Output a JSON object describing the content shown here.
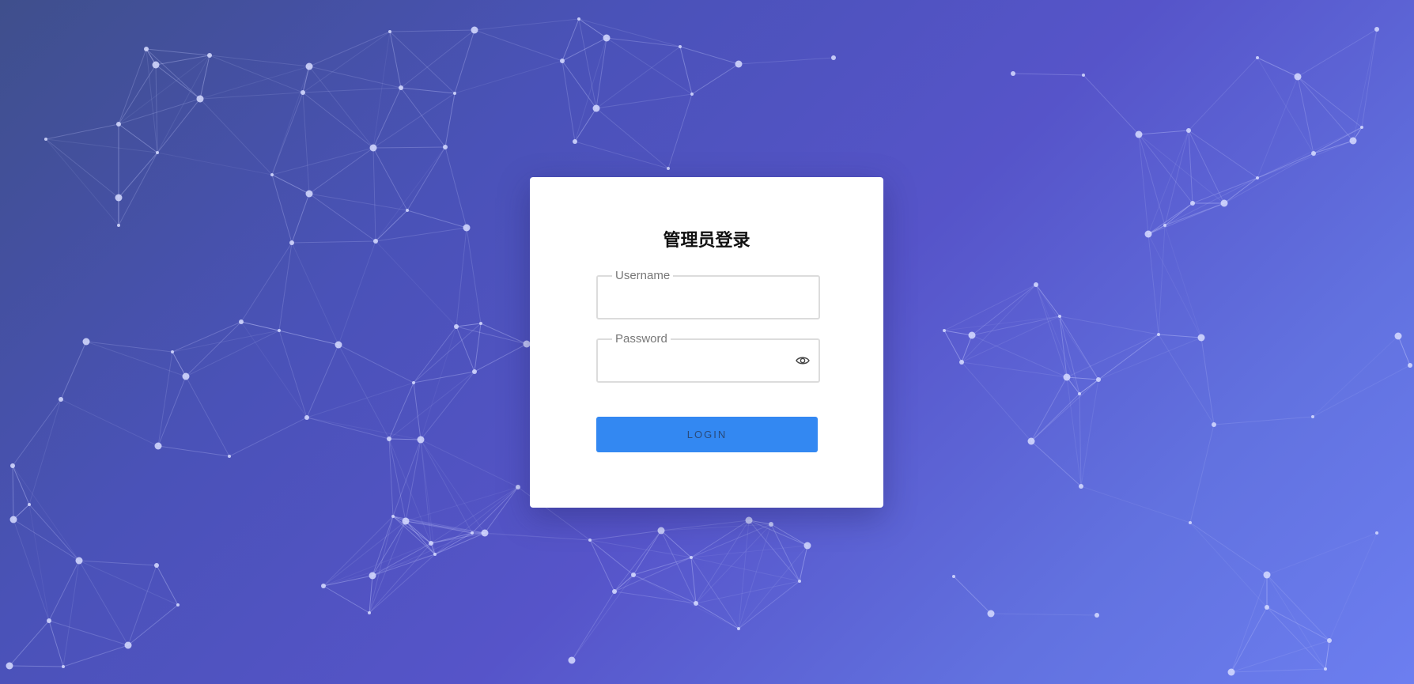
{
  "login": {
    "title": "管理员登录",
    "username_label": "Username",
    "username_value": "",
    "password_label": "Password",
    "password_value": "",
    "login_button": "LOGIN"
  },
  "icons": {
    "password_toggle": "eye-icon"
  },
  "colors": {
    "button": "#3388f2",
    "background_start": "#3f4f8c",
    "background_end": "#6c7ef0"
  }
}
